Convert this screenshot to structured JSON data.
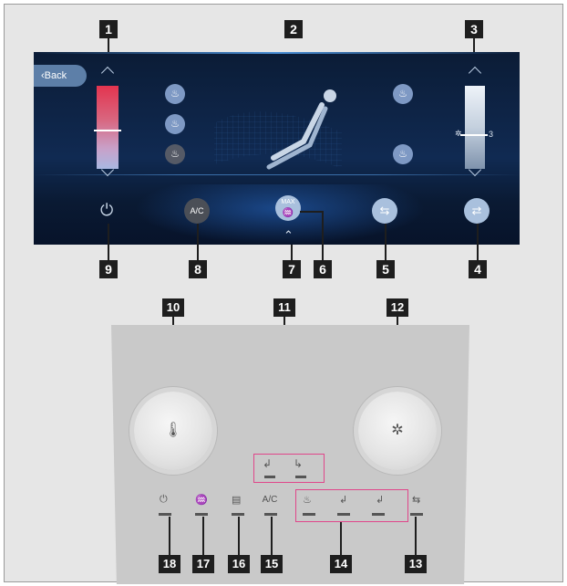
{
  "screen": {
    "back_label": "‹Back",
    "fan_level": "3",
    "ac_label": "A/C",
    "max_label": "MAX"
  },
  "panel": {
    "ac_label": "A/C"
  },
  "callouts": {
    "c1": "1",
    "c2": "2",
    "c3": "3",
    "c4": "4",
    "c5": "5",
    "c6": "6",
    "c7": "7",
    "c8": "8",
    "c9": "9",
    "c10": "10",
    "c11": "11",
    "c12": "12",
    "c13": "13",
    "c14": "14",
    "c15": "15",
    "c16": "16",
    "c17": "17",
    "c18": "18"
  },
  "icons": {
    "power": "power-icon",
    "defrost": "defrost-icon",
    "recirculation": "recirculation-icon",
    "fresh_air": "fresh-air-icon",
    "temperature": "thermometer-icon",
    "fan": "fan-icon",
    "seat_heating": "seat-heating-icon",
    "seat_ventilation": "seat-ventilation-icon",
    "airflow_direction": "airflow-direction-icon"
  }
}
